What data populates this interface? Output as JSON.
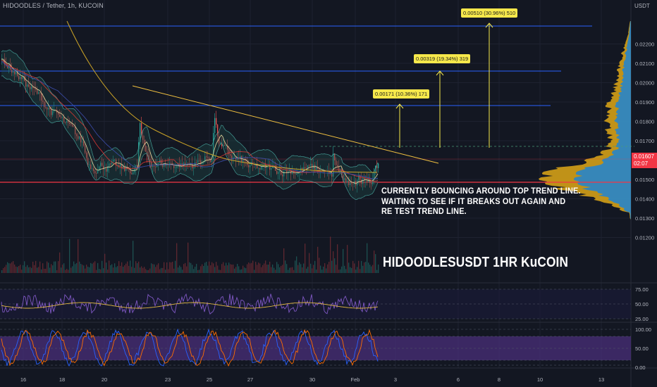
{
  "header": {
    "symbol_line": "HIDOODLES / Tether, 1h, KUCOIN",
    "currency": "USDT"
  },
  "price_axis": {
    "labels": [
      "0.02200",
      "0.02100",
      "0.02000",
      "0.01900",
      "0.01800",
      "0.01700",
      "0.01500",
      "0.01400",
      "0.01300",
      "0.01200"
    ],
    "current_price": "0.01607",
    "countdown": "02:07",
    "current_color": "#f23645"
  },
  "rsi_axis": {
    "labels": [
      "75.00",
      "50.00",
      "25.00"
    ]
  },
  "stoch_axis": {
    "labels": [
      "100.00",
      "50.00",
      "0.00"
    ]
  },
  "time_axis": {
    "labels": [
      "16",
      "18",
      "20",
      "23",
      "25",
      "27",
      "30",
      "Feb",
      "3",
      "6",
      "8",
      "10",
      "13"
    ]
  },
  "targets": [
    {
      "text": "0.00510 (30.96%) 510"
    },
    {
      "text": "0.00319 (19.34%) 319"
    },
    {
      "text": "0.00171 (10.36%) 171"
    }
  ],
  "annotation": {
    "line1": "CURRENTLY BOUNCING AROUND TOP TREND LINE.",
    "line2": "WAITING TO SEE IF IT BREAKS OUT AGAIN AND",
    "line3": "RE TEST TREND LINE."
  },
  "title": "HIDOODLESUSDT 1HR KuCOIN",
  "colors": {
    "background": "#131722",
    "target_lines": "#2962ff",
    "support_line": "#f23645",
    "trend_line": "#f0c040",
    "label_fill": "#f6e84b",
    "volume_profile_up": "#2e86c1",
    "volume_profile_down": "#d4a017",
    "rsi_line": "#7e57c2",
    "stoch_fill": "#4a2f7a"
  }
}
